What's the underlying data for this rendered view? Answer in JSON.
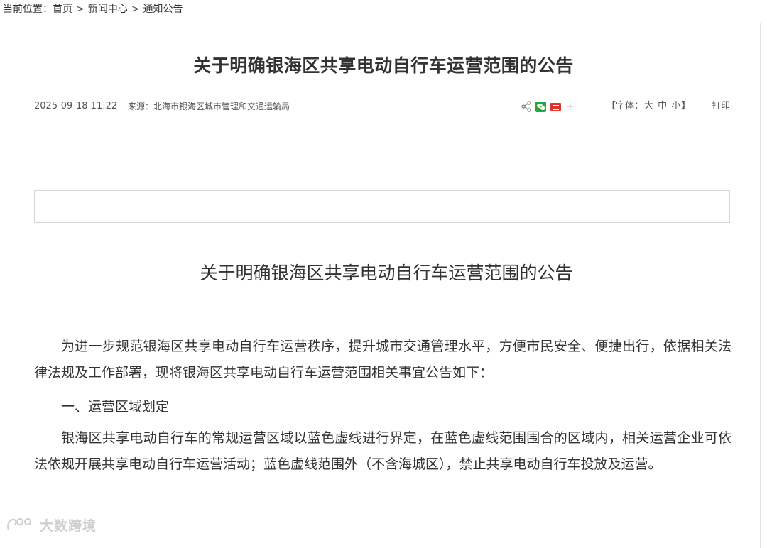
{
  "breadcrumb": {
    "prefix": "当前位置：",
    "items": [
      "首页",
      "新闻中心",
      "通知公告"
    ],
    "separator": ">"
  },
  "article": {
    "title": "关于明确银海区共享电动自行车运营范围的公告",
    "date": "2025-09-18 11:22",
    "source": "来源：北海市银海区城市管理和交通运输局",
    "share_plus": "+",
    "font_size": {
      "open": "【字体：",
      "large": "大",
      "medium": "中",
      "small": "小",
      "close": "】"
    },
    "print": "打印"
  },
  "content": {
    "title": "关于明确银海区共享电动自行车运营范围的公告",
    "paragraphs": [
      "为进一步规范银海区共享电动自行车运营秩序，提升城市交通管理水平，方便市民安全、便捷出行，依据相关法律法规及工作部署，现将银海区共享电动自行车运营范围相关事宜公告如下：",
      "一、运营区域划定",
      "银海区共享电动自行车的常规运营区域以蓝色虚线进行界定，在蓝色虚线范围围合的区域内，相关运营企业可依法依规开展共享电动自行车运营活动；蓝色虚线范围外（不含海城区），禁止共享电动自行车投放及运营。"
    ]
  },
  "watermark": {
    "text": "大数跨境"
  },
  "icons": {
    "share": "share-icon",
    "wechat": "wechat-icon",
    "toutiao": "toutiao-icon",
    "plus": "plus-icon",
    "logo": "watermark-logo-icon"
  },
  "colors": {
    "text": "#333333",
    "meta": "#555555",
    "border": "#e3e3e3",
    "wechat": "#22a93a",
    "toutiao": "#e0312c",
    "watermark": "#cfcfcf"
  }
}
